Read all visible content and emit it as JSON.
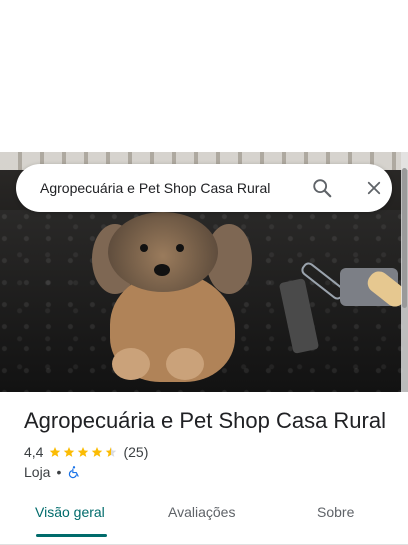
{
  "search": {
    "value": "Agropecuária e Pet Shop Casa Rural",
    "search_icon": "search-icon",
    "close_icon": "close-icon"
  },
  "place": {
    "title": "Agropecuária e Pet Shop Casa Rural",
    "rating": "4,4",
    "rating_value": 4.4,
    "reviews": "(25)",
    "type": "Loja",
    "separator": "•",
    "accessibility_icon": "wheelchair-icon"
  },
  "tabs": [
    {
      "label": "Visão geral",
      "active": true
    },
    {
      "label": "Avaliações",
      "active": false
    },
    {
      "label": "Sobre",
      "active": false
    }
  ],
  "colors": {
    "accent": "#006b6b",
    "star": "#fbbc04",
    "accessibility_blue": "#1a73e8"
  }
}
